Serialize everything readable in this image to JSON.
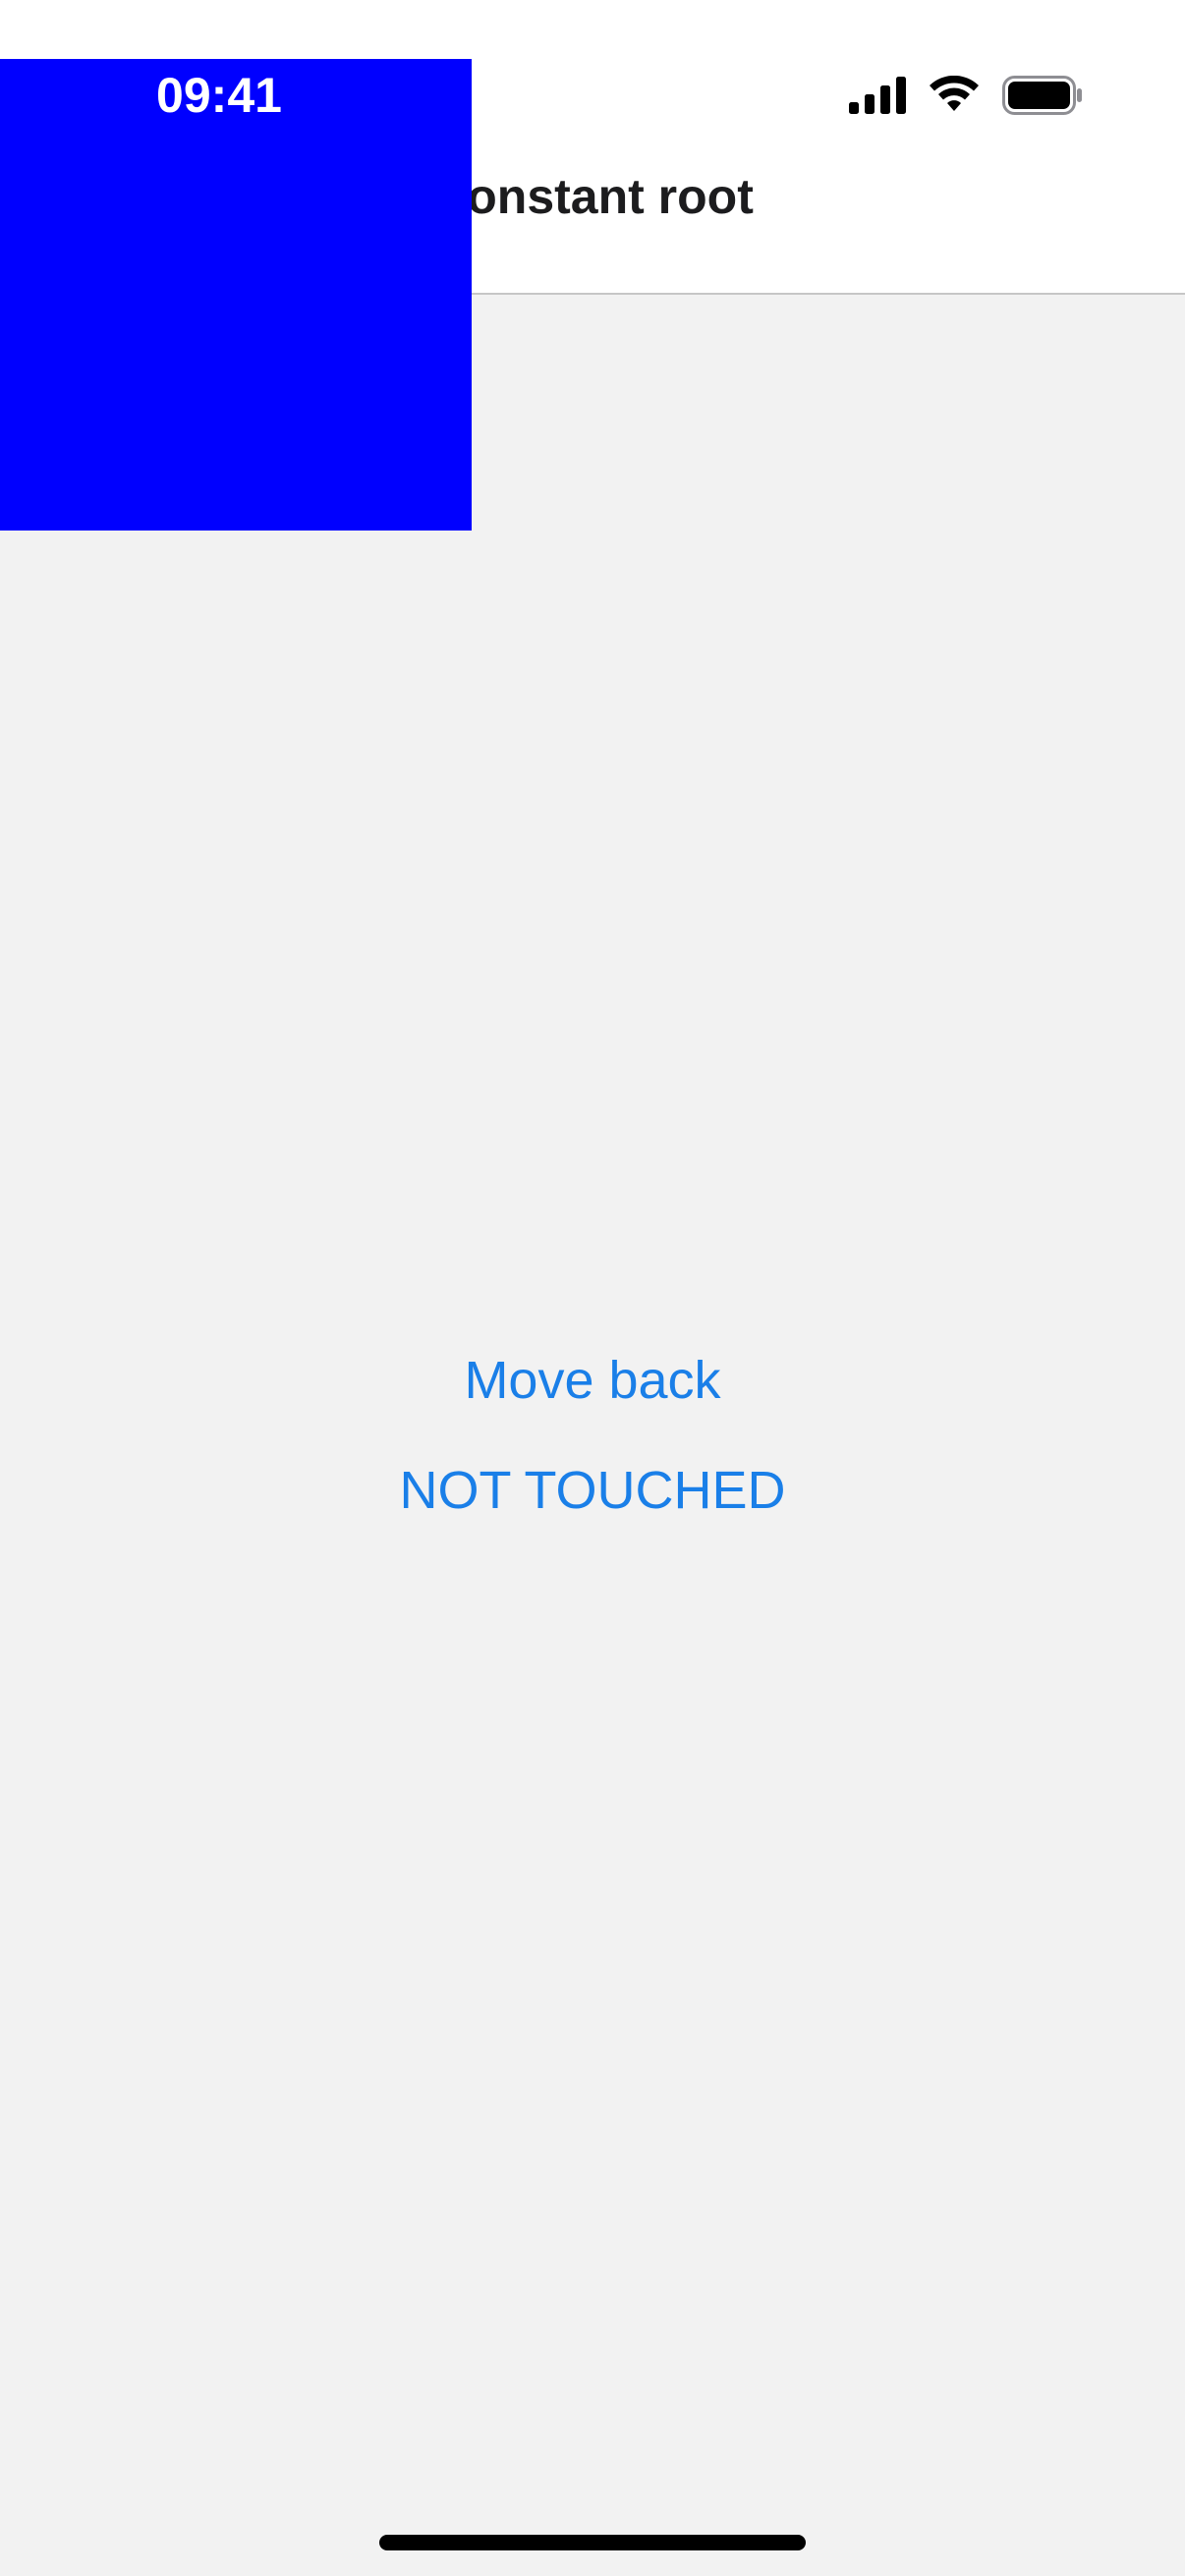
{
  "status_bar": {
    "time": "09:41",
    "icons": [
      "signal-icon",
      "wifi-icon",
      "battery-icon"
    ]
  },
  "nav": {
    "title": "Constant root"
  },
  "overlay": {
    "color": "#0000ff"
  },
  "buttons": {
    "move_back": "Move back",
    "not_touched": "NOT TOUCHED"
  },
  "colors": {
    "accent": "#1a7fe8",
    "background": "#f2f2f2",
    "nav_background": "#ffffff"
  }
}
